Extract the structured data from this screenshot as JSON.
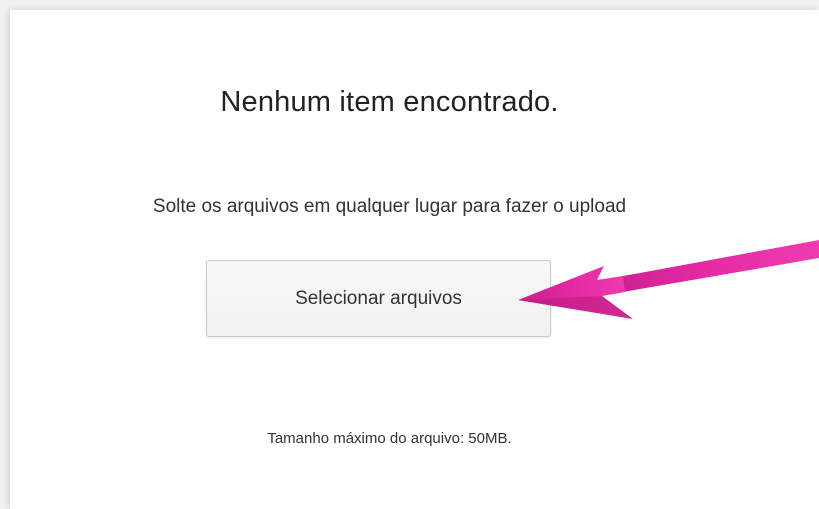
{
  "uploader": {
    "empty_title": "Nenhum item encontrado.",
    "drop_instructions": "Solte os arquivos em qualquer lugar para fazer o upload",
    "select_button_label": "Selecionar arquivos",
    "max_size_text": "Tamanho máximo do arquivo: 50MB."
  },
  "annotation": {
    "arrow_color": "#e0299e",
    "icon": "pointer-arrow-icon"
  }
}
